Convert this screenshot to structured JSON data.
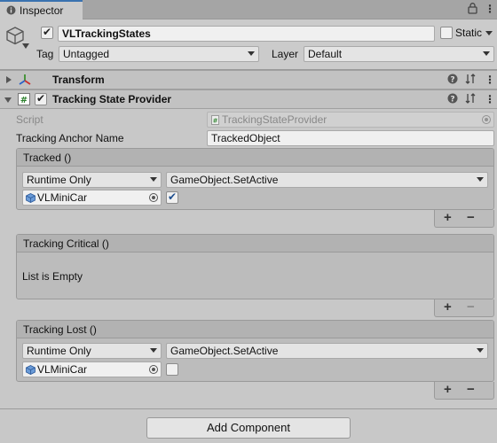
{
  "tab": {
    "label": "Inspector"
  },
  "header": {
    "object_name": "VLTrackingStates",
    "active": true,
    "static_label": "Static",
    "tag_label": "Tag",
    "tag_value": "Untagged",
    "layer_label": "Layer",
    "layer_value": "Default"
  },
  "transform": {
    "title": "Transform"
  },
  "component": {
    "title": "Tracking State Provider",
    "enabled": true,
    "script_label": "Script",
    "script_value": "TrackingStateProvider",
    "anchor_label": "Tracking Anchor Name",
    "anchor_value": "TrackedObject"
  },
  "events": {
    "tracked": {
      "title": "Tracked ()",
      "mode": "Runtime Only",
      "function": "GameObject.SetActive",
      "target": "VLMiniCar",
      "argument": true
    },
    "critical": {
      "title": "Tracking Critical ()",
      "empty_text": "List is Empty"
    },
    "lost": {
      "title": "Tracking Lost ()",
      "mode": "Runtime Only",
      "function": "GameObject.SetActive",
      "target": "VLMiniCar",
      "argument": false
    }
  },
  "buttons": {
    "add_component": "Add Component",
    "plus": "+",
    "minus": "−"
  },
  "icons": {
    "lock": "🔒",
    "menu": "⋮",
    "help": "?",
    "settings": "⇵"
  }
}
